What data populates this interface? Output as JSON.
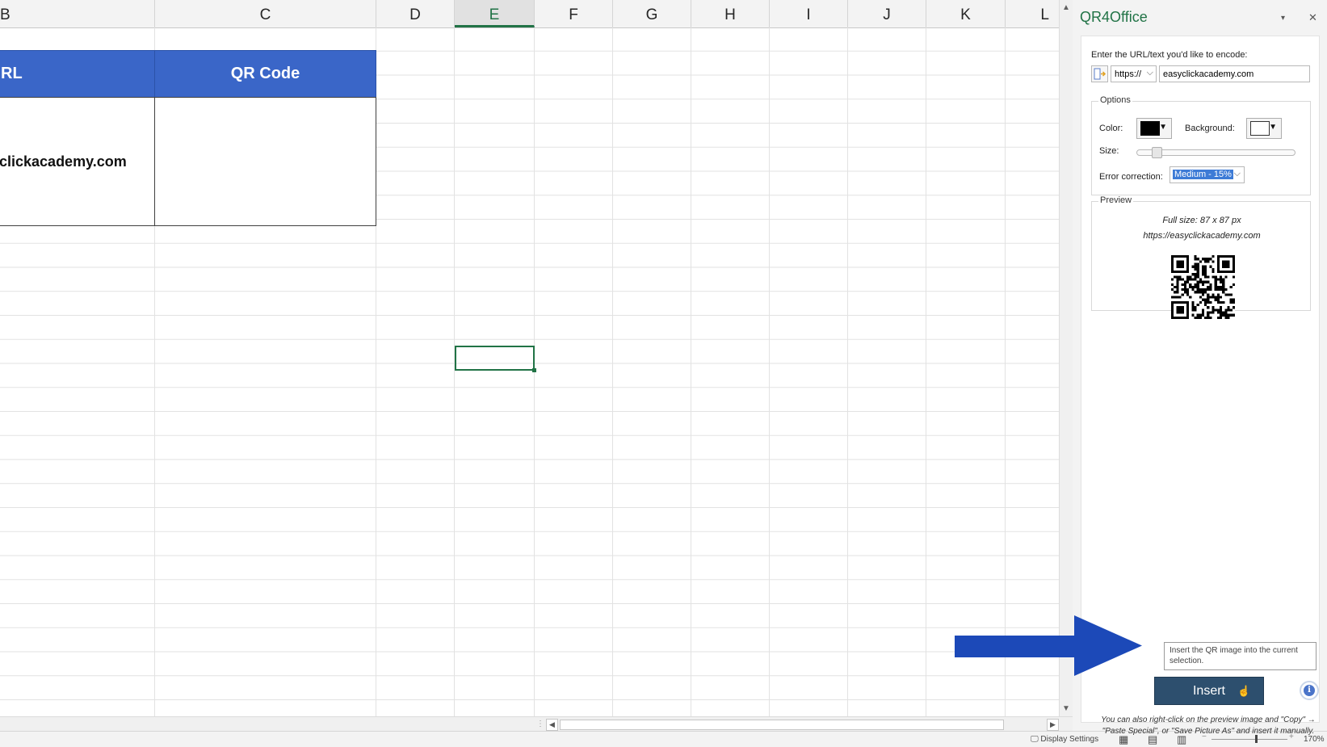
{
  "sheet": {
    "columns": [
      "B",
      "C",
      "D",
      "E",
      "F",
      "G",
      "H",
      "I",
      "J",
      "K",
      "L"
    ],
    "selected_column": "E",
    "header_row": {
      "col_b": "RL",
      "col_c": "QR Code"
    },
    "data_row": {
      "col_b": "clickacademy.com",
      "col_c": ""
    }
  },
  "pane": {
    "title": "QR4Office",
    "encode_label": "Enter the URL/text you'd like to encode:",
    "protocol": "https://",
    "url_value": "easyclickacademy.com",
    "options_legend": "Options",
    "color_label": "Color:",
    "background_label": "Background:",
    "size_label": "Size:",
    "size_fraction": 0.1,
    "error_label": "Error correction:",
    "error_value": "Medium - 15%",
    "preview_legend": "Preview",
    "preview_size": "Full size: 87 x 87 px",
    "preview_url": "https://easyclickacademy.com",
    "tooltip": "Insert the QR image into the current selection.",
    "insert_label": "Insert",
    "info_glyph": "i",
    "footnote": "You can also right-click on the preview image and \"Copy\" → \"Paste Special\", or \"Save Picture As\" and insert it manually."
  },
  "statusbar": {
    "display_settings": "Display Settings",
    "zoom": "170%"
  },
  "colors": {
    "header_fill": "#3a66c8",
    "accent": "#217346",
    "insert_button": "#2d4f6e",
    "arrow": "#1c49b8",
    "qr_color": "#000000",
    "qr_background": "#ffffff"
  }
}
